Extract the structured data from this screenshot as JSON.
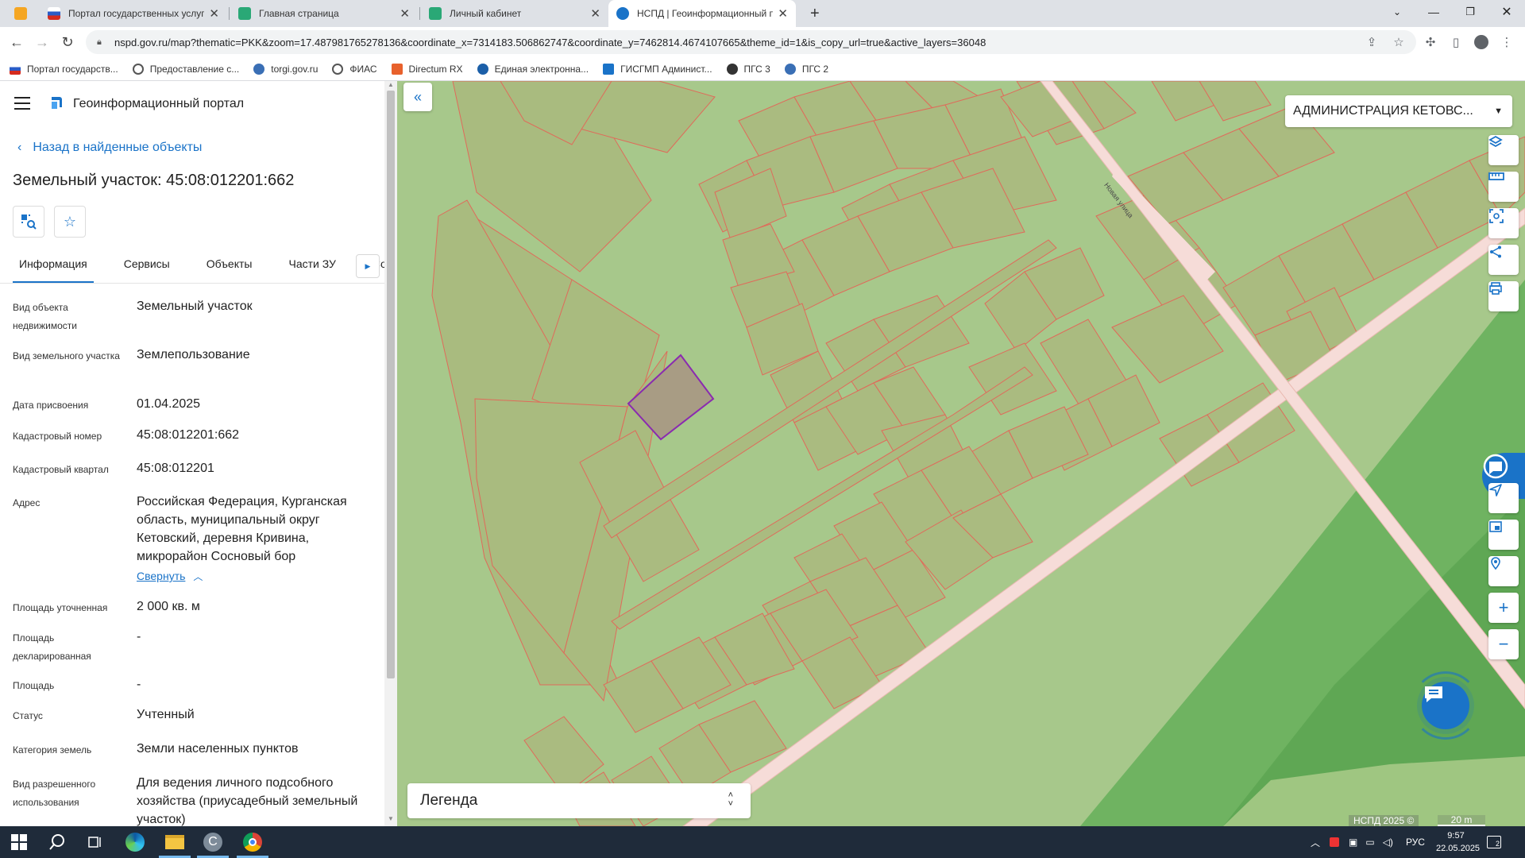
{
  "browser": {
    "tabs": [
      {
        "title": "",
        "favicon_color": "#f5a623"
      },
      {
        "title": "Портал государственных услуг",
        "favicon_color": "#d52b1e"
      },
      {
        "title": "Главная страница",
        "favicon_color": "#2aa876"
      },
      {
        "title": "Личный кабинет",
        "favicon_color": "#2aa876"
      },
      {
        "title": "НСПД | Геоинформационный п",
        "favicon_color": "#1a73c8"
      }
    ],
    "url": "nspd.gov.ru/map?thematic=PKK&zoom=17.487981765278136&coordinate_x=7314183.506862747&coordinate_y=7462814.4674107665&theme_id=1&is_copy_url=true&active_layers=36048",
    "bookmarks": [
      {
        "label": "Портал государств...",
        "color": "#d52b1e"
      },
      {
        "label": "Предоставление с...",
        "color": "#555555"
      },
      {
        "label": "torgi.gov.ru",
        "color": "#3a6fb5"
      },
      {
        "label": "ФИАС",
        "color": "#555555"
      },
      {
        "label": "Directum RX",
        "color": "#e8612c"
      },
      {
        "label": "Единая электронна...",
        "color": "#1b5fa8"
      },
      {
        "label": "ГИСГМП Админист...",
        "color": "#1a73c8"
      },
      {
        "label": "ПГС 3",
        "color": "#333333"
      },
      {
        "label": "ПГС 2",
        "color": "#3a6fb5"
      }
    ]
  },
  "panel": {
    "app_title": "Геоинформационный портал",
    "back_label": "Назад в найденные объекты",
    "object_title": "Земельный участок: 45:08:012201:662",
    "tabs": [
      "Информация",
      "Сервисы",
      "Объекты",
      "Части ЗУ",
      "Соста"
    ],
    "fields": [
      {
        "label": "Вид объекта недвижимости",
        "value": "Земельный участок"
      },
      {
        "label": "Вид земельного участка",
        "value": "Землепользование"
      },
      {
        "label": "Дата присвоения",
        "value": "01.04.2025"
      },
      {
        "label": "Кадастровый номер",
        "value": "45:08:012201:662"
      },
      {
        "label": "Кадастровый квартал",
        "value": "45:08:012201"
      },
      {
        "label": "Адрес",
        "value": "Российская Федерация, Курганская область, муниципальный округ Кетовский, деревня Кривина, микрорайон Сосновый бор"
      },
      {
        "label": "Площадь уточненная",
        "value": "2 000 кв. м"
      },
      {
        "label": "Площадь декларированная",
        "value": "-"
      },
      {
        "label": "Площадь",
        "value": "-"
      },
      {
        "label": "Статус",
        "value": "Учтенный"
      },
      {
        "label": "Категория земель",
        "value": "Земли населенных пунктов"
      },
      {
        "label": "Вид разрешенного использования",
        "value": "Для ведения личного подсобного хозяйства (приусадебный земельный участок)"
      }
    ],
    "collapse_label": "Свернуть"
  },
  "map": {
    "admin_select": "АДМИНИСТРАЦИЯ КЕТОВС...",
    "legend_label": "Легенда",
    "street_label": "Новая улица",
    "copyright": "НСПД 2025 ©",
    "scale": "20 m",
    "colors": {
      "base": "#a7c88b",
      "parcel_fill": "#aabb80",
      "parcel_stroke": "#e06a5a",
      "selected_fill": "#a89c84",
      "selected_stroke": "#8a2ab0",
      "forest": "#5fa754",
      "road": "#f6dcd8"
    }
  },
  "taskbar": {
    "lang": "РУС",
    "time": "9:57",
    "date": "22.05.2025",
    "notifications": "2"
  }
}
